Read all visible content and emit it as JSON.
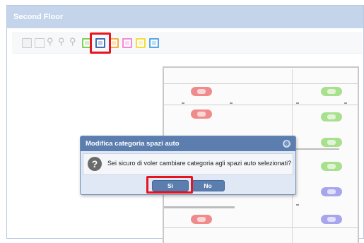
{
  "window": {
    "title": "Second Floor"
  },
  "toolbar": {
    "buttons": [
      {
        "icon": "edit-icon"
      },
      {
        "icon": "select-icon"
      },
      {
        "icon": "zoom-in-icon"
      },
      {
        "icon": "zoom-out-icon"
      },
      {
        "icon": "zoom-reset-icon"
      },
      {
        "icon": "green-flag-icon",
        "color": "#7fd15a"
      },
      {
        "icon": "blue-flag-icon",
        "color": "#3f6fb5",
        "highlighted": true
      },
      {
        "icon": "orange-flag-icon",
        "color": "#f5b041"
      },
      {
        "icon": "pink-flag-icon",
        "color": "#f58ad6"
      },
      {
        "icon": "yellow-flag-icon",
        "color": "#f4dd3c"
      },
      {
        "icon": "light-blue-flag-icon",
        "color": "#56a7e8"
      }
    ]
  },
  "dialog": {
    "title": "Modifica categoria spazi auto",
    "close_glyph": "⊗",
    "icon_glyph": "?",
    "message": "Sei sicuro di voler cambiare categoria agli spazi auto selezionati?",
    "yes_label": "Sì",
    "no_label": "No"
  },
  "parking": {
    "left_column": [
      "red",
      "red",
      "red"
    ],
    "right_column": [
      "green",
      "green",
      "green",
      "green",
      "purple",
      "purple"
    ],
    "colors": {
      "red": "#f08b8b",
      "green": "#a8e08e",
      "purple": "#a7a6ec"
    }
  }
}
